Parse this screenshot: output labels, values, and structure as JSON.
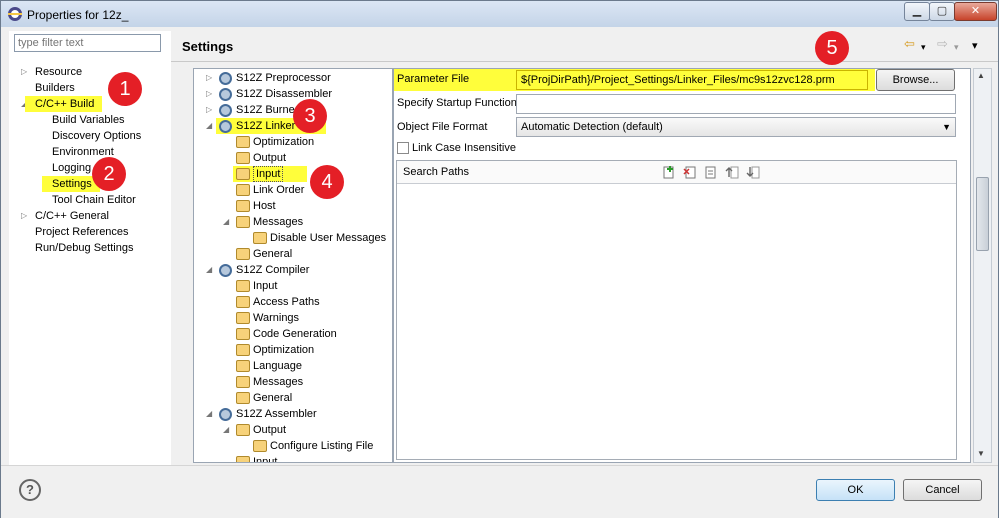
{
  "window": {
    "title": "Properties for 12z_"
  },
  "titlebar_buttons": {
    "minimize": "▁",
    "maximize": "▢",
    "close": "✕"
  },
  "filter": {
    "placeholder": "type filter text"
  },
  "left_tree": [
    {
      "label": "Resource",
      "twisty": "▷"
    },
    {
      "label": "Builders"
    },
    {
      "label": "C/C++ Build",
      "twisty": "◢",
      "highlight": true
    },
    {
      "label": "Build Variables"
    },
    {
      "label": "Discovery Options"
    },
    {
      "label": "Environment"
    },
    {
      "label": "Logging"
    },
    {
      "label": "Settings",
      "highlight": true
    },
    {
      "label": "Tool Chain Editor"
    },
    {
      "label": "C/C++ General",
      "twisty": "▷"
    },
    {
      "label": "Project References"
    },
    {
      "label": "Run/Debug Settings"
    }
  ],
  "header": {
    "title": "Settings",
    "back": "⇦",
    "forward": "⇨",
    "menu": "▾"
  },
  "tool_tree": [
    {
      "label": "S12Z Preprocessor",
      "twisty": "▷"
    },
    {
      "label": "S12Z Disassembler",
      "twisty": "▷"
    },
    {
      "label": "S12Z Burner",
      "twisty": "▷"
    },
    {
      "label": "S12Z Linker",
      "twisty": "◢",
      "highlight": true
    },
    {
      "label": "Optimization"
    },
    {
      "label": "Output"
    },
    {
      "label": "Input",
      "highlight": true,
      "selected": true
    },
    {
      "label": "Link Order"
    },
    {
      "label": "Host"
    },
    {
      "label": "Messages",
      "twisty": "◢"
    },
    {
      "label": "Disable User Messages"
    },
    {
      "label": "General"
    },
    {
      "label": "S12Z Compiler",
      "twisty": "◢"
    },
    {
      "label": "Input"
    },
    {
      "label": "Access Paths"
    },
    {
      "label": "Warnings"
    },
    {
      "label": "Code Generation"
    },
    {
      "label": "Optimization"
    },
    {
      "label": "Language"
    },
    {
      "label": "Messages"
    },
    {
      "label": "General"
    },
    {
      "label": "S12Z Assembler",
      "twisty": "◢"
    },
    {
      "label": "Output",
      "twisty": "◢"
    },
    {
      "label": "Configure Listing File"
    },
    {
      "label": "Input"
    }
  ],
  "form": {
    "parameter_file_label": "Parameter File",
    "parameter_file_value": "${ProjDirPath}/Project_Settings/Linker_Files/mc9s12zvc128.prm",
    "browse_label": "Browse...",
    "startup_label": "Specify Startup Function",
    "startup_value": "",
    "format_label": "Object File Format",
    "format_value": "Automatic Detection (default)",
    "case_label": "Link Case Insensitive",
    "search_paths_label": "Search Paths"
  },
  "callouts": [
    "1",
    "2",
    "3",
    "4",
    "5"
  ],
  "footer": {
    "help": "?",
    "ok": "OK",
    "cancel": "Cancel"
  },
  "colors": {
    "highlight": "#fffe3b",
    "callout": "#e41f26"
  }
}
